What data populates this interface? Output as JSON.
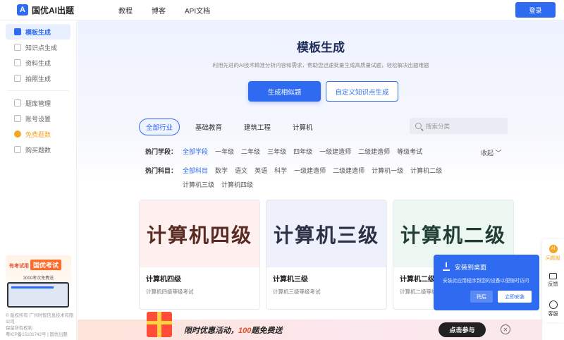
{
  "header": {
    "logo_text": "国优AI出题",
    "nav": [
      "教程",
      "博客",
      "API文档"
    ],
    "login_label": "登录"
  },
  "sidebar": {
    "items": [
      {
        "label": "模板生成",
        "icon": "template-icon"
      },
      {
        "label": "知识点生成",
        "icon": "knowledge-icon"
      },
      {
        "label": "资料生成",
        "icon": "document-icon"
      },
      {
        "label": "拍照生成",
        "icon": "camera-icon"
      }
    ],
    "items2": [
      {
        "label": "题库管理",
        "icon": "bank-icon"
      },
      {
        "label": "账号设置",
        "icon": "settings-icon"
      },
      {
        "label": "免费题数",
        "icon": "gift-icon"
      },
      {
        "label": "购买题数",
        "icon": "cart-icon"
      }
    ],
    "promo": {
      "left": "有考试用",
      "brand": "国优考试",
      "sub": "3000考次免费送"
    },
    "copyright": "© 版权所有 广州时智信息技术有限公司",
    "rights": "保留所有权利",
    "icp": "粤ICP备15101742号 | 国优出题"
  },
  "hero": {
    "title": "模板生成",
    "subtitle": "利用先进的AI技术精准分析内容和需求，帮助您迅速批量生成高质量试题，轻松解决出题难题",
    "primary_button": "生成相似题",
    "secondary_button": "自定义知识点生成"
  },
  "tabs": [
    "全部行业",
    "基础教育",
    "建筑工程",
    "计算机"
  ],
  "search": {
    "placeholder": "搜索分类"
  },
  "filters": {
    "stage_label": "热门学段：",
    "stages": [
      "全部学段",
      "一年级",
      "二年级",
      "三年级",
      "四年级",
      "一级建造师",
      "二级建造师",
      "等级考试"
    ],
    "collapse": "收起",
    "subject_label": "热门科目：",
    "subjects": [
      "全部科目",
      "数学",
      "语文",
      "英语",
      "科学",
      "一级建造师",
      "二级建造师",
      "计算机一级",
      "计算机二级"
    ],
    "subjects2": [
      "计算机三级",
      "计算机四级"
    ]
  },
  "cards": [
    {
      "thumb": "计算机四级",
      "name": "计算机四级",
      "desc": "计算机四级等级考试"
    },
    {
      "thumb": "计算机三级",
      "name": "计算机三级",
      "desc": "计算机三级等级考试"
    },
    {
      "thumb": "计算机二级",
      "name": "计算机二级",
      "desc": "计算机二级等级考试"
    }
  ],
  "install_popup": {
    "title": "安装到桌面",
    "desc": "安装此应用程序到您的设备以便随时访问",
    "later": "稍后",
    "install": "立即安装"
  },
  "floatbar": {
    "ai": "AI",
    "ai_label": "问题股",
    "feedback": "反馈",
    "service": "客服"
  },
  "banner": {
    "text_a": "限时优惠活动，",
    "text_num": "100",
    "text_b": "题免费送",
    "join": "点击参与"
  },
  "colors": {
    "accent": "#2f6bf0",
    "orange": "#f5a623"
  }
}
